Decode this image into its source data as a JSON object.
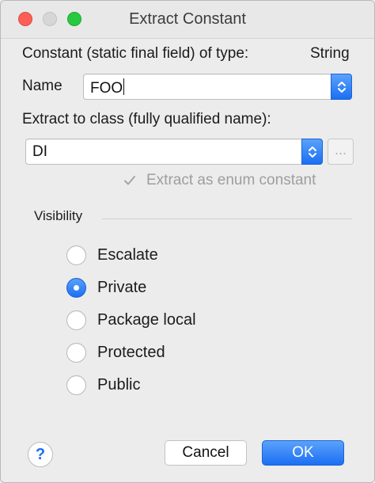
{
  "window": {
    "title": "Extract Constant"
  },
  "form": {
    "constant_type_label": "Constant (static final field) of type:",
    "constant_type_value": "String",
    "name_label": "Name",
    "name_value": "FOO",
    "class_label": "Extract to class (fully qualified name):",
    "class_value": "DI",
    "browse_label": "...",
    "enum_checkbox": {
      "label": "Extract as enum constant",
      "checked": true,
      "enabled": false
    }
  },
  "visibility": {
    "title": "Visibility",
    "options": [
      {
        "label": "Escalate",
        "selected": false
      },
      {
        "label": "Private",
        "selected": true
      },
      {
        "label": "Package local",
        "selected": false
      },
      {
        "label": "Protected",
        "selected": false
      },
      {
        "label": "Public",
        "selected": false
      }
    ]
  },
  "buttons": {
    "help": "?",
    "cancel": "Cancel",
    "ok": "OK"
  },
  "colors": {
    "accent": "#1b6ff2",
    "close": "#fd5f57",
    "zoom": "#28c940"
  },
  "icons": {
    "stepper": "chevron-up-down-icon",
    "check": "checkmark-icon",
    "help": "question-mark-icon"
  }
}
